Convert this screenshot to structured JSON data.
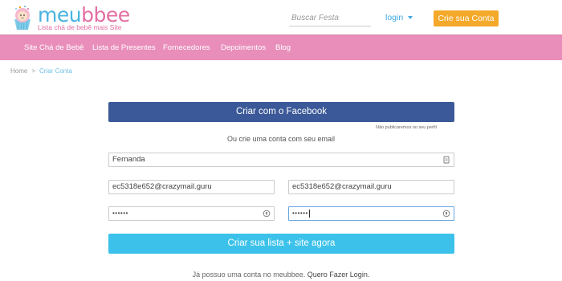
{
  "header": {
    "logo_prefix": "meu",
    "logo_suffix": "bbee",
    "logo_tagline": "Lista chá de bebê mais Site",
    "search_placeholder": "Buscar Festa",
    "login_label": "login",
    "signup_label": "Crie sua Conta"
  },
  "nav": {
    "items": [
      "Site Chá de Bebê",
      "Lista de Presentes",
      "Fornecedores",
      "Depoimentos",
      "Blog"
    ]
  },
  "breadcrumb": {
    "home": "Home",
    "separator": ">",
    "current": "Criar Conta"
  },
  "form": {
    "facebook_button": "Criar com o Facebook",
    "facebook_note": "Não publicaremos no seu perfil",
    "or_text": "Ou crie uma conta com seu email",
    "name_value": "Fernanda",
    "email_value": "ec5318e652@crazymail.guru",
    "email_confirm_value": "ec5318e652@crazymail.guru",
    "password_value": "••••••",
    "password_confirm_value": "••••••",
    "submit_button": "Criar sua lista + site agora",
    "login_prompt": "Já possuo uma conta no meubbee.",
    "login_link": "Quero Fazer Login."
  },
  "colors": {
    "nav_bg": "#e98eba",
    "facebook": "#3b5998",
    "cta": "#3cc2ea",
    "signup": "#f4a92a"
  }
}
